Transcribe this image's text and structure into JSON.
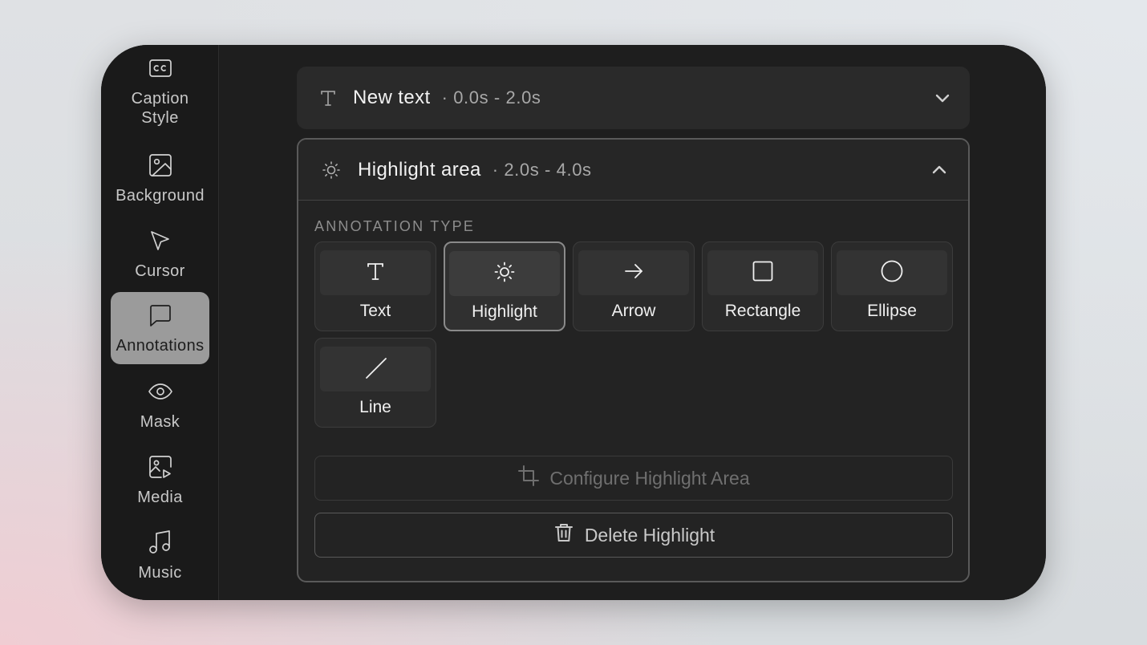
{
  "sidebar": {
    "items": [
      {
        "label": "Caption\nStyle",
        "icon": "cc-icon"
      },
      {
        "label": "Background",
        "icon": "image-icon"
      },
      {
        "label": "Cursor",
        "icon": "cursor-icon"
      },
      {
        "label": "Annotations",
        "icon": "message-icon",
        "active": true
      },
      {
        "label": "Mask",
        "icon": "eye-icon"
      },
      {
        "label": "Media",
        "icon": "media-icon"
      },
      {
        "label": "Music",
        "icon": "music-icon"
      }
    ]
  },
  "annotations": [
    {
      "title": "New text",
      "time": "· 0.0s - 2.0s",
      "icon": "text-icon",
      "expanded": false
    },
    {
      "title": "Highlight area",
      "time": "· 2.0s - 4.0s",
      "icon": "sun-icon",
      "expanded": true
    }
  ],
  "editor": {
    "section_label": "ANNOTATION TYPE",
    "types": [
      {
        "label": "Text",
        "icon": "text-icon"
      },
      {
        "label": "Highlight",
        "icon": "sun-icon",
        "selected": true
      },
      {
        "label": "Arrow",
        "icon": "arrow-right-icon"
      },
      {
        "label": "Rectangle",
        "icon": "square-icon"
      },
      {
        "label": "Ellipse",
        "icon": "circle-icon"
      },
      {
        "label": "Line",
        "icon": "line-icon"
      }
    ],
    "configure_label": "Configure Highlight Area",
    "delete_label": "Delete Highlight"
  }
}
